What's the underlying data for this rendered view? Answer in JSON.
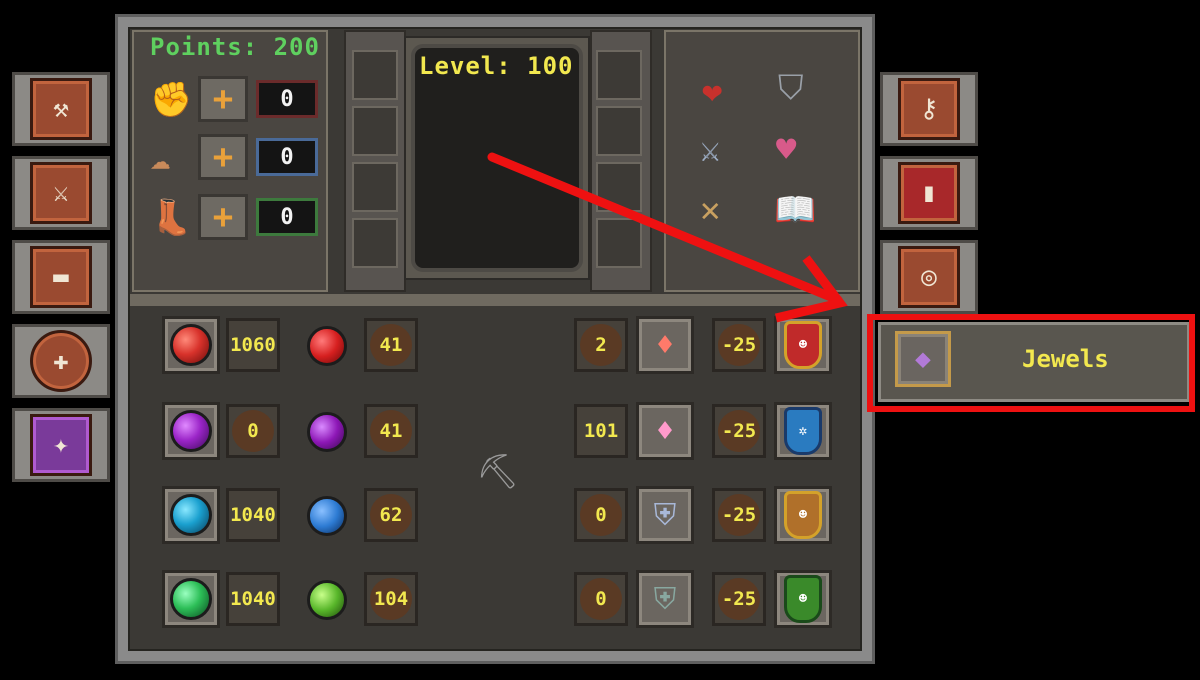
{
  "header": {
    "points_label": "Points: 200",
    "level_label": "Level: 100"
  },
  "attributes": [
    {
      "icon": "fist-icon",
      "value": "0"
    },
    {
      "icon": "brain-icon",
      "value": "0"
    },
    {
      "icon": "boot-icon",
      "value": "0"
    }
  ],
  "plus_glyph": "+",
  "left_tabs": [
    "scythe-icon",
    "sword-shield-icon",
    "anvil-icon",
    "compass-icon",
    "spellbook-icon"
  ],
  "right_tabs": [
    "key-sword-icon",
    "scroll-book-icon",
    "key-ring-icon"
  ],
  "stat_icons": [
    "heart-icon",
    "shield-icon",
    "crossed-swords-icon",
    "heart-sword-icon",
    "crossed-spears-icon",
    "open-book-icon"
  ],
  "orbs": [
    {
      "color": "#d8322b",
      "value": "1060",
      "small_value": "41"
    },
    {
      "color": "#9b25c8",
      "value": "0",
      "small_value": "41"
    },
    {
      "color": "#1aa0cf",
      "value": "1040",
      "small_value": "62"
    },
    {
      "color": "#2dbf58",
      "value": "1040",
      "small_value": "104"
    }
  ],
  "small_orb_colors": [
    "#d61f1f",
    "#8d17b6",
    "#2d7bd3",
    "#58b62a"
  ],
  "resists": [
    {
      "count": "2",
      "icon": "gem-icon",
      "mod": "-25",
      "shield_color": "#c02a2a"
    },
    {
      "count": "101",
      "icon": "gem-sword-icon",
      "mod": "-25",
      "shield_color": "#2a7bc0"
    },
    {
      "count": "0",
      "icon": "chest-armor-icon",
      "mod": "-25",
      "shield_color": "#d49b2a"
    },
    {
      "count": "0",
      "icon": "chain-armor-icon",
      "mod": "-25",
      "shield_color": "#59a82a"
    }
  ],
  "jewels_tab": {
    "label": "Jewels"
  },
  "colors": {
    "annotation": "#ee1111",
    "points": "#5fd05f",
    "level": "#f2e84f"
  }
}
